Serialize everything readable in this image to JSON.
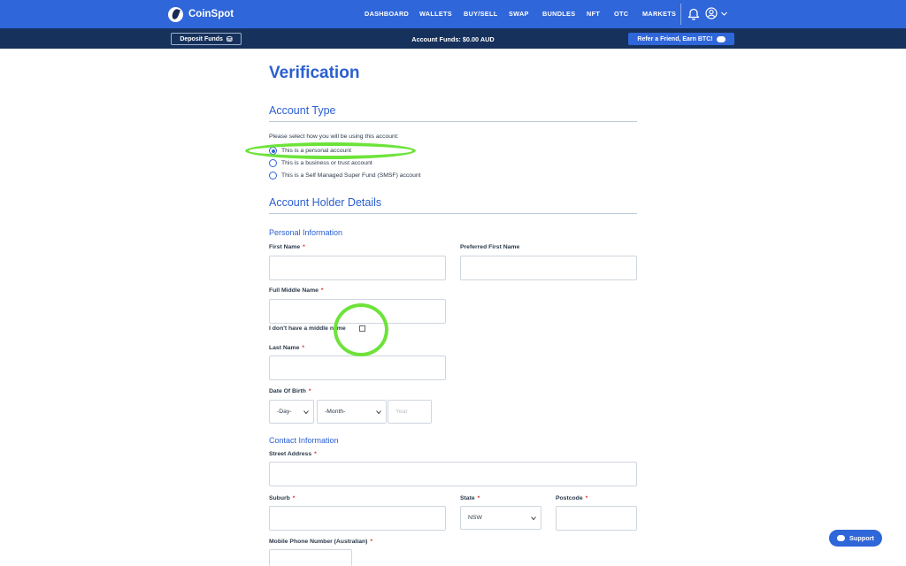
{
  "brand": {
    "name": "CoinSpot",
    "logo": "coinspot-logo-icon"
  },
  "nav": {
    "items": [
      "DASHBOARD",
      "WALLETS",
      "BUY/SELL",
      "SWAP",
      "BUNDLES",
      "NFT",
      "OTC",
      "MARKETS"
    ],
    "icons": [
      "bell-icon",
      "user-icon",
      "chevron-down-icon"
    ]
  },
  "subbar": {
    "deposit_label": "Deposit Funds",
    "account_funds": "Account Funds: $0.00 AUD",
    "refer_label": "Refer a Friend, Earn BTC!"
  },
  "page": {
    "title": "Verification"
  },
  "account_type": {
    "heading": "Account Type",
    "prompt": "Please select how you will be using this account:",
    "options": [
      {
        "label": "This is a personal account",
        "selected": true
      },
      {
        "label": "This is a business or trust account",
        "selected": false
      },
      {
        "label": "This is a Self Managed Super Fund (SMSF) account",
        "selected": false
      }
    ]
  },
  "holder": {
    "heading": "Account Holder Details",
    "personal_heading": "Personal Information",
    "first_name_label": "First Name",
    "preferred_first_name_label": "Preferred First Name",
    "middle_name_label": "Full Middle Name",
    "no_middle_label": "I don't have a middle name",
    "last_name_label": "Last Name",
    "dob_label": "Date Of Birth",
    "dob_day": "-Day-",
    "dob_month": "-Month-",
    "dob_year_placeholder": "Year",
    "required_mark": "*"
  },
  "contact": {
    "heading": "Contact Information",
    "street_label": "Street Address",
    "suburb_label": "Suburb",
    "state_label": "State",
    "state_value": "NSW",
    "postcode_label": "Postcode",
    "mobile_label": "Mobile Phone Number (Australian)"
  },
  "support": {
    "label": "Support"
  },
  "colors": {
    "brand_blue": "#2f66d9",
    "navy": "#16315c",
    "highlight_green": "#6de33a",
    "required_red": "#e0322f"
  }
}
